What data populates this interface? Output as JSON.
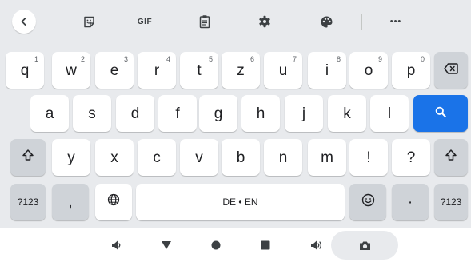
{
  "toolbar": {
    "items": [
      {
        "name": "back-chevron-icon"
      },
      {
        "name": "sticker-icon"
      },
      {
        "name": "gif-button",
        "label": "GIF"
      },
      {
        "name": "clipboard-icon"
      },
      {
        "name": "gear-icon"
      },
      {
        "name": "palette-icon"
      },
      {
        "name": "more-icon",
        "label": "•••"
      }
    ]
  },
  "keyboard": {
    "row1": [
      {
        "label": "q",
        "hint": "1"
      },
      {
        "label": "w",
        "hint": "2"
      },
      {
        "label": "e",
        "hint": "3"
      },
      {
        "label": "r",
        "hint": "4"
      },
      {
        "label": "t",
        "hint": "5"
      },
      {
        "label": "z",
        "hint": "6"
      },
      {
        "label": "u",
        "hint": "7"
      },
      {
        "label": "i",
        "hint": "8"
      },
      {
        "label": "o",
        "hint": "9"
      },
      {
        "label": "p",
        "hint": "0"
      }
    ],
    "row2": [
      "a",
      "s",
      "d",
      "f",
      "g",
      "h",
      "j",
      "k",
      "l"
    ],
    "row3": [
      "y",
      "x",
      "c",
      "v",
      "b",
      "n",
      "m",
      "!",
      "?"
    ],
    "row4": {
      "symbols_label": "?123",
      "comma_label": ",",
      "space_label": "DE • EN",
      "period_label": "·",
      "symbols_right_label": "?123"
    },
    "icons": {
      "backspace": "backspace-icon",
      "search": "search-icon",
      "shift": "shift-icon",
      "globe": "globe-icon",
      "emoji": "emoji-icon"
    },
    "accent_color": "#1a73e8"
  },
  "navbar": {
    "items": [
      "volume-down-icon",
      "back-triangle-icon",
      "home-circle-icon",
      "recents-square-icon",
      "volume-up-icon",
      "screenshot-camera-icon"
    ]
  }
}
